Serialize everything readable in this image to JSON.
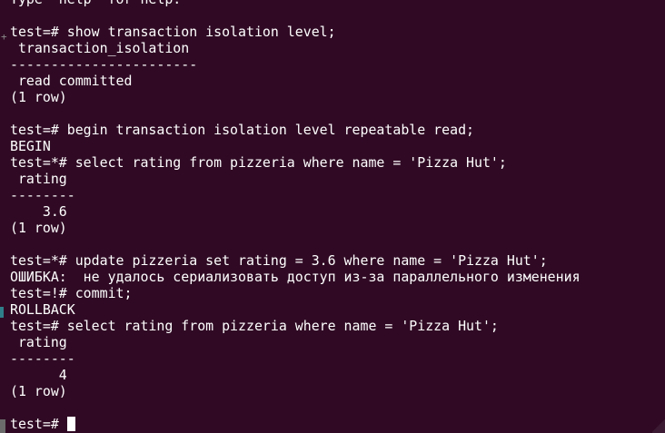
{
  "colors": {
    "background": "#300a24",
    "text": "#ffffff"
  },
  "terminal": {
    "lines": [
      "Type  help  for help.",
      "",
      "test=# show transaction isolation level;",
      " transaction_isolation",
      "-----------------------",
      " read committed",
      "(1 row)",
      "",
      "test=# begin transaction isolation level repeatable read;",
      "BEGIN",
      "test=*# select rating from pizzeria where name = 'Pizza Hut';",
      " rating",
      "--------",
      "    3.6",
      "(1 row)",
      "",
      "test=*# update pizzeria set rating = 3.6 where name = 'Pizza Hut';",
      "ОШИБКА:  не удалось сериализовать доступ из-за параллельного изменения",
      "test=!# commit;",
      "ROLLBACK",
      "test=# select rating from pizzeria where name = 'Pizza Hut';",
      " rating",
      "--------",
      "      4",
      "(1 row)",
      ""
    ],
    "prompt": "test=#",
    "icons": {
      "cursor": "block-cursor"
    }
  }
}
